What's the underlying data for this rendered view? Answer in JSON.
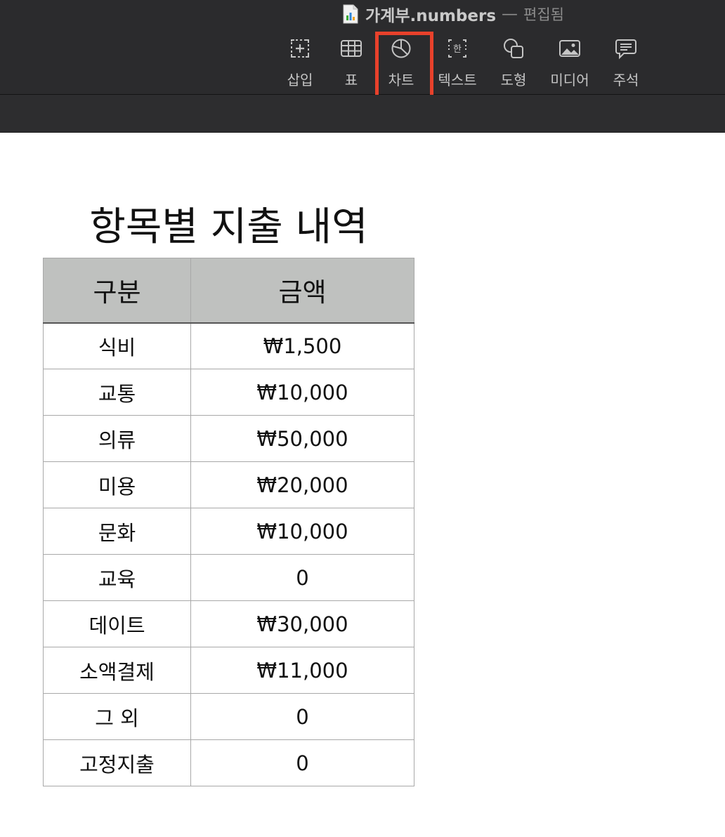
{
  "window": {
    "doc_name": "가계부.numbers",
    "separator": "—",
    "status": "편집됨"
  },
  "toolbar": {
    "items": [
      {
        "label": "삽입",
        "icon": "insert-icon"
      },
      {
        "label": "표",
        "icon": "table-icon"
      },
      {
        "label": "차트",
        "icon": "chart-icon"
      },
      {
        "label": "텍스트",
        "icon": "text-icon"
      },
      {
        "label": "도형",
        "icon": "shape-icon"
      },
      {
        "label": "미디어",
        "icon": "media-icon"
      },
      {
        "label": "주석",
        "icon": "comment-icon"
      }
    ],
    "highlighted": "차트",
    "highlight_color": "#e8412b",
    "text_icon_glyph": "한"
  },
  "sheet": {
    "title": "항목별 지출 내역",
    "table": {
      "headers": [
        "구분",
        "금액"
      ],
      "rows": [
        [
          "식비",
          "₩1,500"
        ],
        [
          "교통",
          "₩10,000"
        ],
        [
          "의류",
          "₩50,000"
        ],
        [
          "미용",
          "₩20,000"
        ],
        [
          "문화",
          "₩10,000"
        ],
        [
          "교육",
          "0"
        ],
        [
          "데이트",
          "₩30,000"
        ],
        [
          "소액결제",
          "₩11,000"
        ],
        [
          "그 외",
          "0"
        ],
        [
          "고정지출",
          "0"
        ]
      ]
    }
  },
  "colors": {
    "toolbar_bg": "#2b2b2d",
    "header_bg": "#bfc1bf"
  }
}
